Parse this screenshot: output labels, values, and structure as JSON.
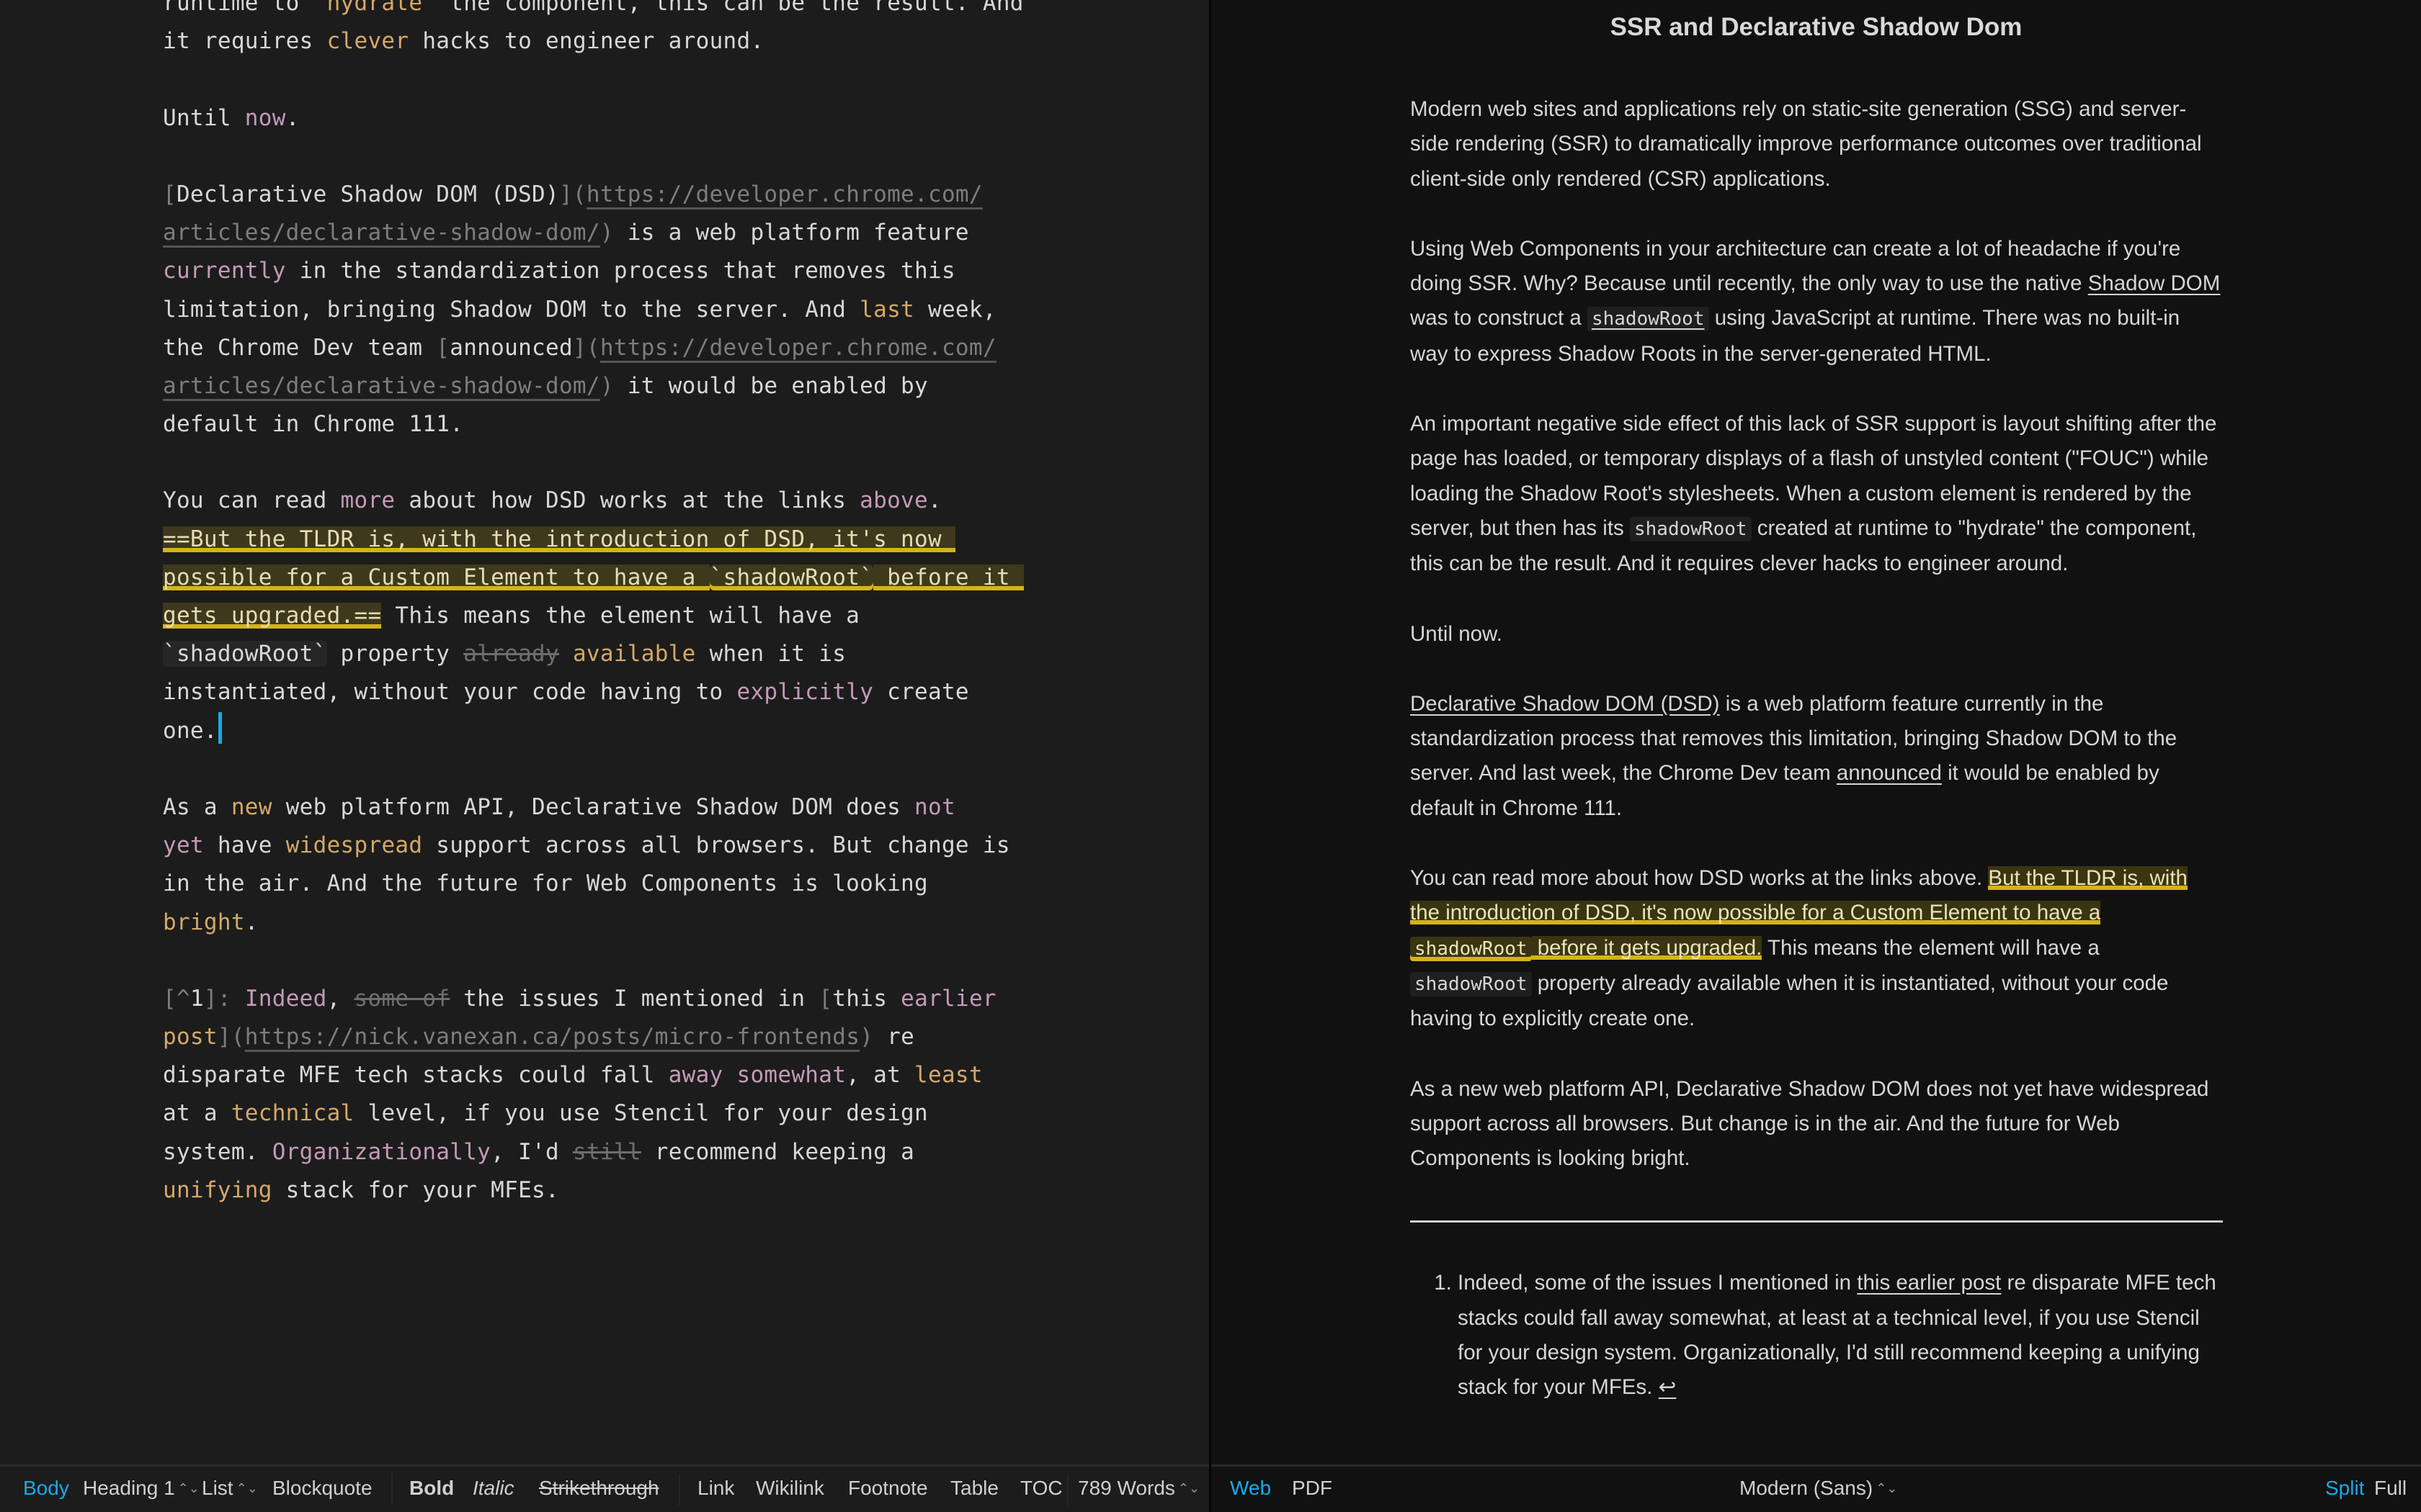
{
  "editor": {
    "lines": [
      [
        [
          "",
          "runtime to \""
        ],
        [
          "gd",
          "hydrate"
        ],
        [
          "",
          "\" the component, this can be the result. And"
        ]
      ],
      [
        [
          "",
          "it requires "
        ],
        [
          "gd",
          "clever"
        ],
        [
          "",
          " hacks to engineer around."
        ]
      ],
      [],
      [
        [
          "",
          "Until "
        ],
        [
          "pk",
          "now"
        ],
        [
          "",
          "."
        ]
      ],
      [],
      [
        [
          "mk",
          "["
        ],
        [
          "",
          "Declarative Shadow DOM (DSD)"
        ],
        [
          "mk",
          "]("
        ],
        [
          "url",
          "https://developer.chrome.com/"
        ]
      ],
      [
        [
          "url",
          "articles/declarative-shadow-dom/"
        ],
        [
          "mk",
          ")"
        ],
        [
          "",
          " is a web platform feature"
        ]
      ],
      [
        [
          "pk",
          "currently"
        ],
        [
          "",
          " in the standardization process that removes this"
        ]
      ],
      [
        [
          "",
          "limitation, bringing Shadow DOM to the server. And "
        ],
        [
          "gd",
          "last"
        ],
        [
          "",
          " week,"
        ]
      ],
      [
        [
          "",
          "the Chrome Dev team "
        ],
        [
          "mk",
          "["
        ],
        [
          "",
          "announced"
        ],
        [
          "mk",
          "]("
        ],
        [
          "url",
          "https://developer.chrome.com/"
        ]
      ],
      [
        [
          "url",
          "articles/declarative-shadow-dom/"
        ],
        [
          "mk",
          ")"
        ],
        [
          "",
          " it would be enabled by"
        ]
      ],
      [
        [
          "",
          "default in Chrome 111."
        ]
      ],
      [],
      [
        [
          "",
          "You can read "
        ],
        [
          "pk",
          "more"
        ],
        [
          "",
          " about how DSD works at the links "
        ],
        [
          "pk",
          "above"
        ],
        [
          "",
          "."
        ]
      ],
      [
        [
          "hl",
          "==But the TLDR is, with the introduction of DSD, it's "
        ],
        [
          "hlpk",
          "now"
        ],
        [
          "hl",
          " "
        ]
      ],
      [
        [
          "hlgd",
          "possible"
        ],
        [
          "hl",
          " for a Custom Element to have a "
        ],
        [
          "hlcode",
          "`shadowRoot`"
        ],
        [
          "hl",
          " before it "
        ]
      ],
      [
        [
          "hl",
          "gets upgraded.=="
        ],
        [
          "",
          " This means the element will have a"
        ]
      ],
      [
        [
          "code",
          "`shadowRoot`"
        ],
        [
          "",
          " property "
        ],
        [
          "st",
          "already"
        ],
        [
          "",
          " "
        ],
        [
          "gd",
          "available"
        ],
        [
          "",
          " when it is"
        ]
      ],
      [
        [
          "",
          "instantiated, without your code having to "
        ],
        [
          "pk",
          "explicitly"
        ],
        [
          "",
          " create"
        ]
      ],
      [
        [
          "",
          "one."
        ],
        [
          "cursor",
          ""
        ]
      ],
      [],
      [
        [
          "",
          "As a "
        ],
        [
          "gd",
          "new"
        ],
        [
          "",
          " web platform API, Declarative Shadow DOM does "
        ],
        [
          "pk",
          "not"
        ]
      ],
      [
        [
          "pk",
          "yet"
        ],
        [
          "",
          " have "
        ],
        [
          "gd",
          "widespread"
        ],
        [
          "",
          " support across all browsers. But change is"
        ]
      ],
      [
        [
          "",
          "in the air. And the future for Web Components is looking"
        ]
      ],
      [
        [
          "gd",
          "bright"
        ],
        [
          "",
          "."
        ]
      ],
      [],
      [
        [
          "mk",
          "[^"
        ],
        [
          "",
          "1"
        ],
        [
          "mk",
          "]: "
        ],
        [
          "pk",
          "Indeed"
        ],
        [
          "",
          ", "
        ],
        [
          "st",
          "some of"
        ],
        [
          "",
          " the issues I mentioned in "
        ],
        [
          "mk",
          "["
        ],
        [
          "",
          "this "
        ],
        [
          "pk",
          "earlier"
        ]
      ],
      [
        [
          "gd",
          "post"
        ],
        [
          "mk",
          "]("
        ],
        [
          "url",
          "https://nick.vanexan.ca/posts/micro-frontends"
        ],
        [
          "mk",
          ")"
        ],
        [
          "",
          " re"
        ]
      ],
      [
        [
          "",
          "disparate MFE tech stacks could fall "
        ],
        [
          "pk",
          "away"
        ],
        [
          "",
          " "
        ],
        [
          "pk",
          "somewhat"
        ],
        [
          "",
          ", at "
        ],
        [
          "gd",
          "least"
        ]
      ],
      [
        [
          "",
          "at a "
        ],
        [
          "gd",
          "technical"
        ],
        [
          "",
          " level, if you use Stencil for your design"
        ]
      ],
      [
        [
          "",
          "system. "
        ],
        [
          "pk",
          "Organizationally"
        ],
        [
          "",
          ", I'd "
        ],
        [
          "st",
          "still"
        ],
        [
          "",
          " recommend keeping a"
        ]
      ],
      [
        [
          "gd",
          "unifying"
        ],
        [
          "",
          " stack for your MFEs."
        ]
      ]
    ]
  },
  "preview": {
    "title": "SSR and Declarative Shadow Dom",
    "p1": "Modern web sites and applications rely on static-site generation (SSG) and server-side rendering (SSR) to dramatically improve performance outcomes over traditional client-side only rendered (CSR) applications.",
    "p2": {
      "a": "Using Web Components in your architecture can create a lot of headache if you're doing SSR. Why? Because until recently, the only way to use the native ",
      "link": "Shadow DOM",
      "b": " was to construct a ",
      "code": "shadowRoot",
      "c": " using JavaScript at runtime. There was no built-in way to express Shadow Roots in the server-generated HTML."
    },
    "p3": {
      "a": "An important negative side effect of this lack of SSR support is layout shifting after the page has loaded, or temporary displays of a flash of unstyled content (\"FOUC\") while loading the Shadow Root's stylesheets. When a custom element is rendered by the server, but then has its ",
      "code": "shadowRoot",
      "b": " created at runtime to \"hydrate\" the component, this can be the result. And it requires clever hacks to engineer around."
    },
    "p4": "Until now.",
    "p5": {
      "link1": "Declarative Shadow DOM (DSD)",
      "a": " is a web platform feature currently in the standardization process that removes this limitation, bringing Shadow DOM to the server. And last week, the Chrome Dev team ",
      "link2": "announced",
      "b": " it would be enabled by default in Chrome 111."
    },
    "p6": {
      "a": "You can read more about how DSD works at the links above. ",
      "hl1": "But the TLDR is, with the introduction of DSD, it's now possible for a Custom Element to have a ",
      "hlcode": "shadowRoot",
      "hl2": " before it gets upgraded.",
      "b": " This means the element will have a ",
      "code": "shadowRoot",
      "c": " property already available when it is instantiated, without your code having to explicitly create one."
    },
    "p7": "As a new web platform API, Declarative Shadow DOM does not yet have widespread support across all browsers. But change is in the air. And the future for Web Components is looking bright.",
    "footnote": {
      "a": "Indeed, some of the issues I mentioned in ",
      "link": "this earlier post",
      "b": " re disparate MFE tech stacks could fall away somewhat, at least at a technical level, if you use Stencil for your design system. Organizationally, I'd still recommend keeping a unifying stack for your MFEs. ",
      "backref": "↩"
    }
  },
  "toolbar": {
    "body": "Body",
    "heading": "Heading 1",
    "list": "List",
    "blockquote": "Blockquote",
    "bold": "Bold",
    "italic": "Italic",
    "strikethrough": "Strikethrough",
    "link": "Link",
    "wikilink": "Wikilink",
    "footnote": "Footnote",
    "table": "Table",
    "toc": "TOC",
    "words": "789 Words",
    "updown": "⌃⌄",
    "web": "Web",
    "pdf": "PDF",
    "font": "Modern (Sans)",
    "split": "Split",
    "full": "Full"
  },
  "colors": {
    "accent": "#1aa9e8",
    "highlight": "#d4b416",
    "editor_bg": "#1c1c1c",
    "preview_bg": "#111111"
  }
}
